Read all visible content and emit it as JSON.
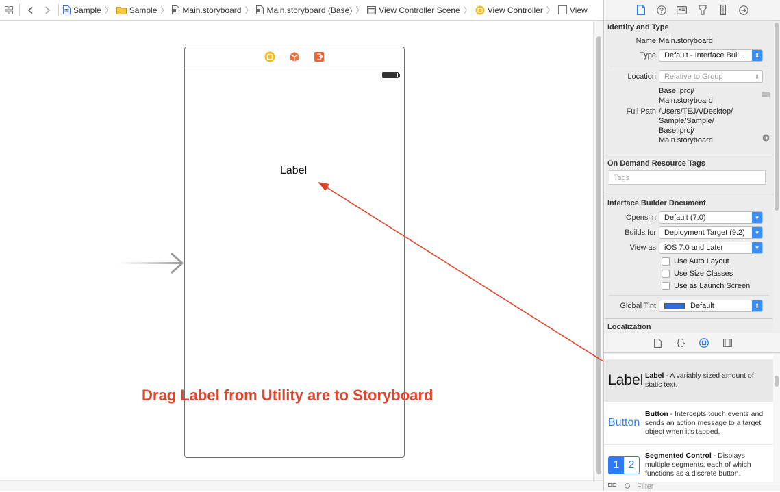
{
  "jumpbar": {
    "crumbs": [
      "Sample",
      "Sample",
      "Main.storyboard",
      "Main.storyboard (Base)",
      "View Controller Scene",
      "View Controller",
      "View"
    ]
  },
  "canvas": {
    "scene_label": "Label",
    "annotation": "Drag Label from Utility are to Storyboard"
  },
  "inspector": {
    "identity": {
      "title": "Identity and Type",
      "name_label": "Name",
      "name_value": "Main.storyboard",
      "type_label": "Type",
      "type_value": "Default - Interface Buil...",
      "location_label": "Location",
      "location_value": "Relative to Group",
      "location_path": "Base.lproj/\nMain.storyboard",
      "fullpath_label": "Full Path",
      "fullpath_value": "/Users/TEJA/Desktop/\nSample/Sample/\nBase.lproj/\nMain.storyboard"
    },
    "odr": {
      "title": "On Demand Resource Tags",
      "tags_placeholder": "Tags"
    },
    "ibdoc": {
      "title": "Interface Builder Document",
      "opens_in_label": "Opens in",
      "opens_in_value": "Default (7.0)",
      "builds_for_label": "Builds for",
      "builds_for_value": "Deployment Target (9.2)",
      "view_as_label": "View as",
      "view_as_value": "iOS 7.0 and Later",
      "checks": [
        "Use Auto Layout",
        "Use Size Classes",
        "Use as Launch Screen"
      ],
      "global_tint_label": "Global Tint",
      "global_tint_value": "Default"
    },
    "localization": {
      "title": "Localization"
    }
  },
  "library": {
    "items": [
      {
        "preview": "Label",
        "name": "Label",
        "desc": " - A variably sized amount of static text."
      },
      {
        "preview": "Button",
        "name": "Button",
        "desc": " - Intercepts touch events and sends an action message to a target object when it's tapped."
      },
      {
        "preview_1": "1",
        "preview_2": "2",
        "name": "Segmented Control",
        "desc": " - Displays multiple segments, each of which functions as a discrete button."
      }
    ],
    "filter_placeholder": "Filter"
  },
  "colors": {
    "annotation": "#e0452c",
    "accent": "#3b8ef5",
    "tint": "#2e6fd6"
  }
}
